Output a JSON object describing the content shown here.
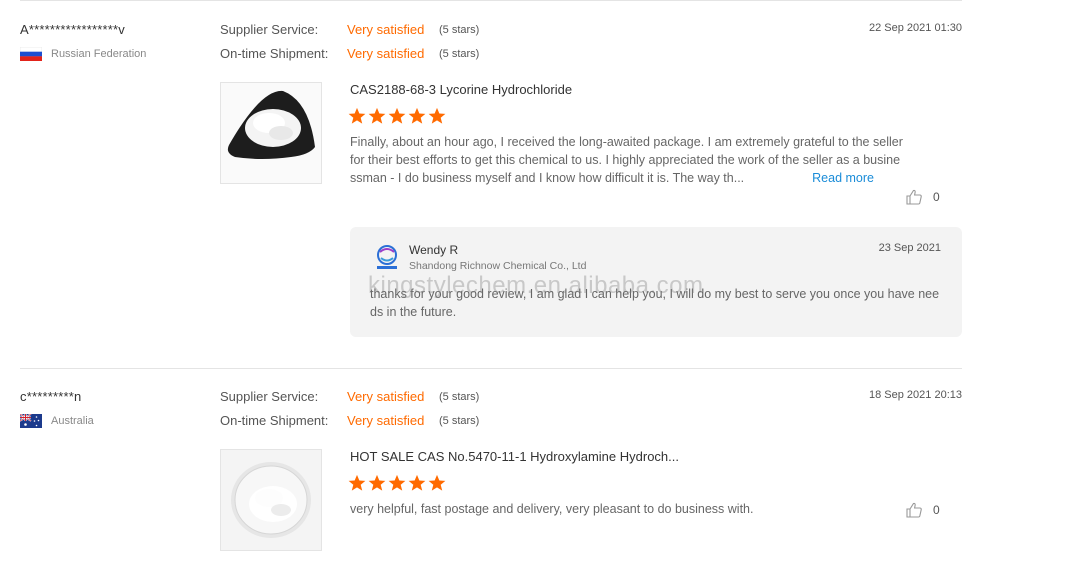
{
  "reviews": [
    {
      "reviewer": "A*****************v",
      "country": "Russian Federation",
      "flag_icon": "russia-flag-icon",
      "supplier_service_label": "Supplier Service:",
      "supplier_service_value": "Very satisfied",
      "supplier_service_stars": "(5 stars)",
      "shipment_label": "On-time Shipment:",
      "shipment_value": "Very satisfied",
      "shipment_stars": "(5 stars)",
      "date": "22 Sep 2021 01:30",
      "product_title": "CAS2188-68-3 Lycorine Hydrochloride",
      "rating": 5,
      "text": "Finally, about an hour ago, I received the long-awaited package. I am extremely grateful to the seller for their best efforts to get this chemical to us. I highly appreciated the work of the seller as a businessman - I do business myself and I know how difficult it is. The way th...",
      "read_more": "Read more",
      "likes": "0",
      "reply": {
        "name": "Wendy R",
        "company": "Shandong Richnow Chemical Co., Ltd",
        "date": "23 Sep 2021",
        "text": "thanks for your good review, I am glad I can help you, I will do my best to serve you once you have needs in the future."
      }
    },
    {
      "reviewer": "c*********n",
      "country": "Australia",
      "flag_icon": "australia-flag-icon",
      "supplier_service_label": "Supplier Service:",
      "supplier_service_value": "Very satisfied",
      "supplier_service_stars": "(5 stars)",
      "shipment_label": "On-time Shipment:",
      "shipment_value": "Very satisfied",
      "shipment_stars": "(5 stars)",
      "date": "18 Sep 2021 20:13",
      "product_title": "HOT SALE CAS No.5470-11-1 Hydroxylamine Hydroch...",
      "rating": 5,
      "text": "very helpful, fast postage and delivery, very pleasant to do business with.",
      "likes": "0"
    }
  ],
  "watermark": "kingstylechem.en.alibaba.com",
  "colors": {
    "accent": "#ff6a00",
    "link": "#1a8cd8",
    "star": "#ff6a00"
  }
}
